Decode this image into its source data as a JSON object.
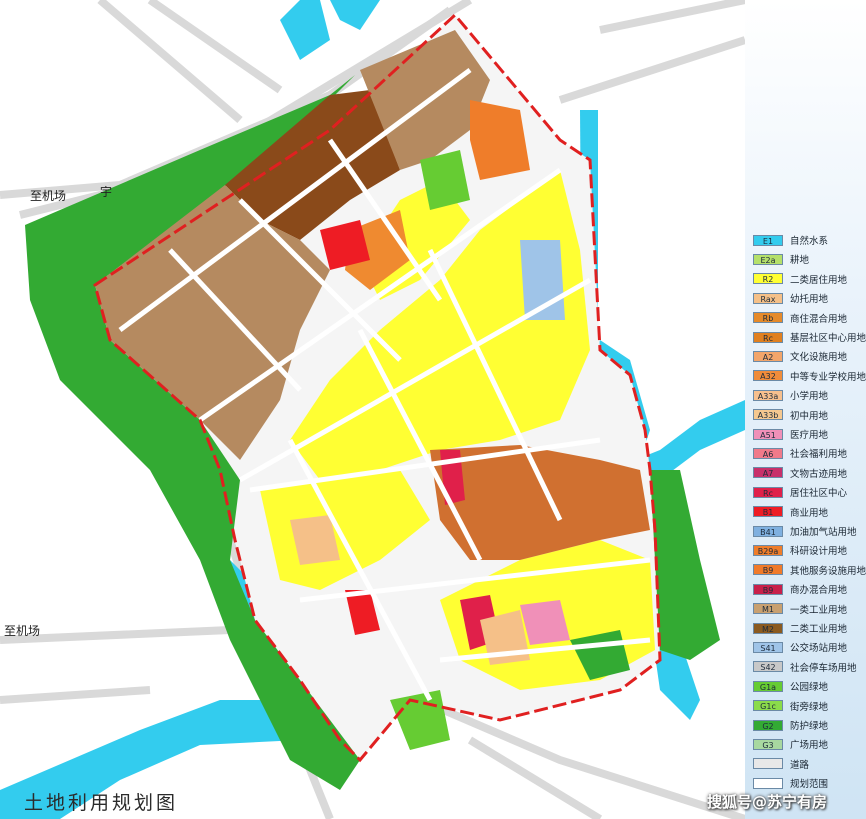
{
  "title": "土地利用规划图",
  "watermark": "搜狐号@苏宁有房",
  "places": {
    "airport_road_left": "至机场",
    "airport_road_top": "至机场",
    "yu": "宇"
  },
  "legend": [
    {
      "code": "E1",
      "label": "自然水系",
      "color": "#33ccee"
    },
    {
      "code": "E2a",
      "label": "耕地",
      "color": "#b5e06a"
    },
    {
      "code": "R2",
      "label": "二类居住用地",
      "color": "#ffff33"
    },
    {
      "code": "Rax",
      "label": "幼托用地",
      "color": "#f5c088"
    },
    {
      "code": "Rb",
      "label": "商住混合用地",
      "color": "#e58a2a"
    },
    {
      "code": "Rc",
      "label": "基层社区中心用地",
      "color": "#e08020"
    },
    {
      "code": "A2",
      "label": "文化设施用地",
      "color": "#f2a56a"
    },
    {
      "code": "A32",
      "label": "中等专业学校用地",
      "color": "#f08c3a"
    },
    {
      "code": "A33a",
      "label": "小学用地",
      "color": "#f7c08e"
    },
    {
      "code": "A33b",
      "label": "初中用地",
      "color": "#f5c890"
    },
    {
      "code": "A51",
      "label": "医疗用地",
      "color": "#f090b8"
    },
    {
      "code": "A6",
      "label": "社会福利用地",
      "color": "#f07a8a"
    },
    {
      "code": "A7",
      "label": "文物古迹用地",
      "color": "#c8306a"
    },
    {
      "code": "Rc",
      "label": "居住社区中心",
      "color": "#e0204a"
    },
    {
      "code": "B1",
      "label": "商业用地",
      "color": "#ee1c24"
    },
    {
      "code": "B41",
      "label": "加油加气站用地",
      "color": "#7fb0e0"
    },
    {
      "code": "B29a",
      "label": "科研设计用地",
      "color": "#ef7d2a"
    },
    {
      "code": "B9",
      "label": "其他服务设施用地",
      "color": "#f07a2a"
    },
    {
      "code": "B9",
      "label": "商办混合用地",
      "color": "#c8204a"
    },
    {
      "code": "M1",
      "label": "一类工业用地",
      "color": "#c8a070"
    },
    {
      "code": "M2",
      "label": "二类工业用地",
      "color": "#8a5a20"
    },
    {
      "code": "S41",
      "label": "公交场站用地",
      "color": "#9fc4e8"
    },
    {
      "code": "S42",
      "label": "社会停车场用地",
      "color": "#c8c8c8"
    },
    {
      "code": "G1a",
      "label": "公园绿地",
      "color": "#66cc33"
    },
    {
      "code": "G1c",
      "label": "街旁绿地",
      "color": "#8bdc4a"
    },
    {
      "code": "G2",
      "label": "防护绿地",
      "color": "#33aa33"
    },
    {
      "code": "G3",
      "label": "广场用地",
      "color": "#a8d8a0"
    },
    {
      "code": "",
      "label": "道路",
      "color": "#e8e8e8"
    },
    {
      "code": "",
      "label": "规划范围",
      "color": "#ffffff"
    }
  ]
}
